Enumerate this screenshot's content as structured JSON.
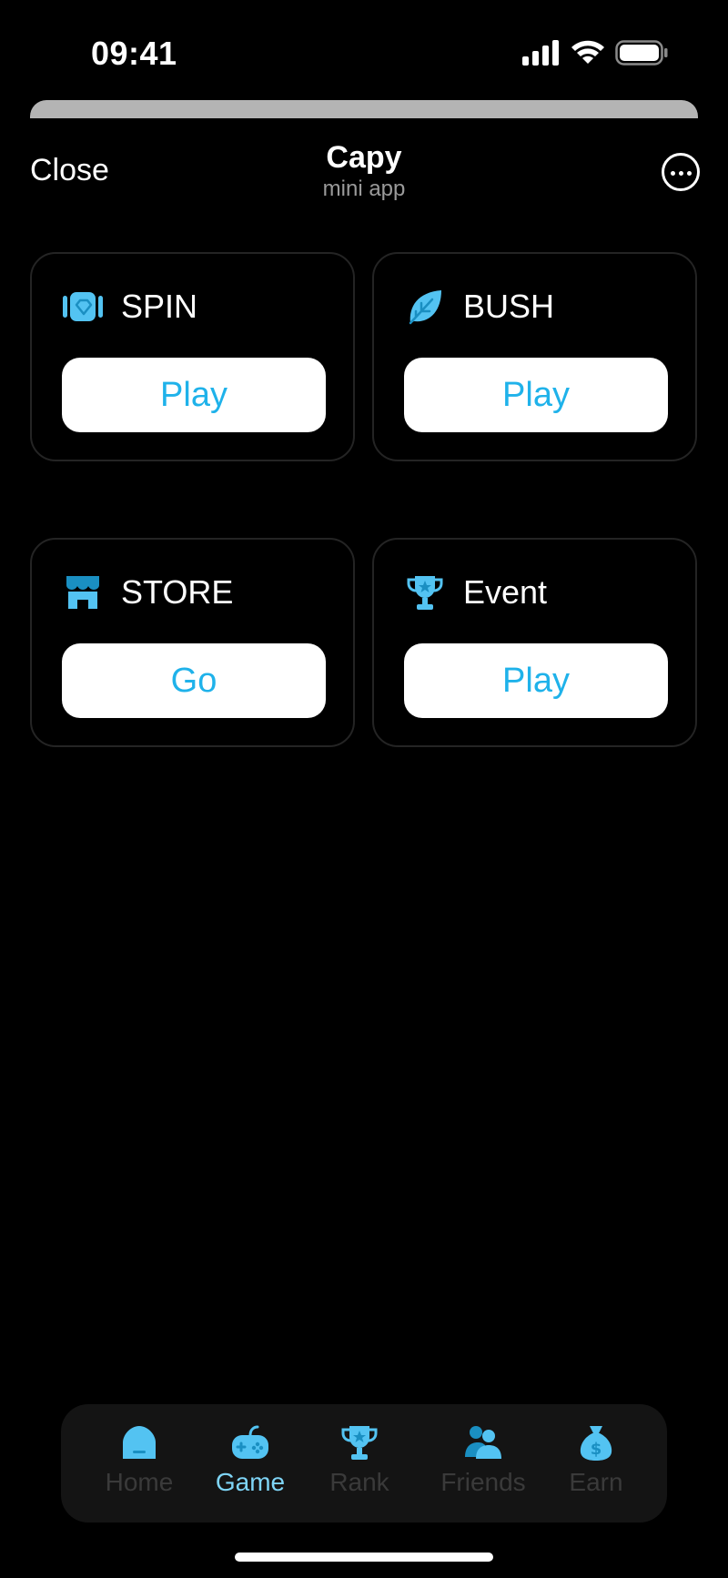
{
  "status_bar": {
    "time": "09:41"
  },
  "header": {
    "close_label": "Close",
    "title": "Capy",
    "subtitle": "mini app"
  },
  "cards": [
    {
      "title": "SPIN",
      "icon": "spin-icon",
      "button": "Play"
    },
    {
      "title": "BUSH",
      "icon": "leaf-icon",
      "button": "Play"
    },
    {
      "title": "STORE",
      "icon": "store-icon",
      "button": "Go"
    },
    {
      "title": "Event",
      "icon": "trophy-icon",
      "button": "Play"
    }
  ],
  "tabs": [
    {
      "label": "Home",
      "icon": "home-icon",
      "active": false
    },
    {
      "label": "Game",
      "icon": "gamepad-icon",
      "active": true
    },
    {
      "label": "Rank",
      "icon": "trophy-icon",
      "active": false
    },
    {
      "label": "Friends",
      "icon": "friends-icon",
      "active": false
    },
    {
      "label": "Earn",
      "icon": "money-bag-icon",
      "active": false
    }
  ],
  "colors": {
    "accent": "#1fb2ea",
    "icon": "#53c3f2",
    "active_tab": "#7fd5f7",
    "inactive_tab": "#3a3a3a"
  }
}
